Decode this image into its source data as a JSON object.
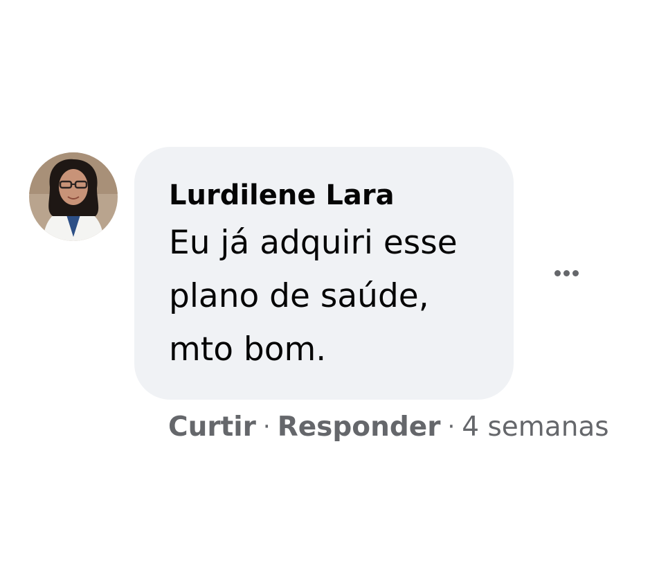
{
  "comment": {
    "author": "Lurdilene Lara",
    "avatar_icon": "profile-photo",
    "message": "Eu já adquiri esse plano de saúde, mto bom.",
    "more_icon": "more-options-ellipsis-icon",
    "actions": {
      "like_label": "Curtir",
      "reply_label": "Responder",
      "separator": "·",
      "timestamp": "4 semanas"
    }
  },
  "colors": {
    "bubble_background": "#f0f2f5",
    "text_primary": "#050505",
    "text_secondary": "#65676b"
  }
}
